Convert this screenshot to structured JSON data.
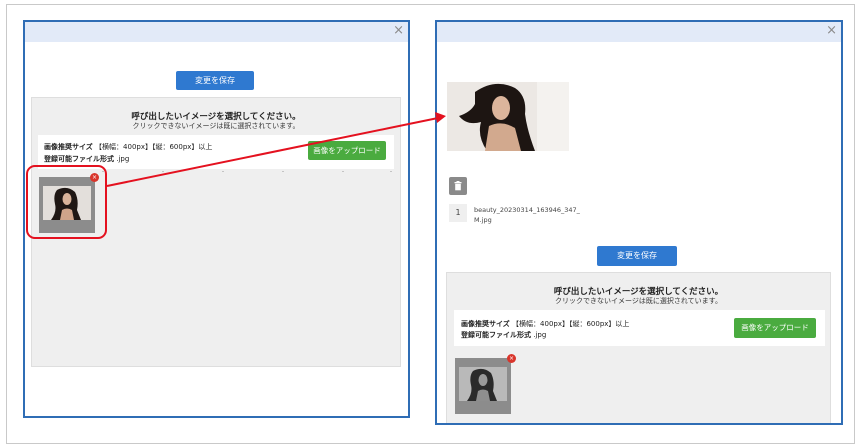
{
  "left_dialog": {
    "close_glyph": "×",
    "save_label": "変更を保存",
    "panel_title": "呼び出したいイメージを選択してください。",
    "panel_subtitle": "クリックできないイメージは既に選択されています。",
    "size_label": "画像推奨サイズ",
    "size_value": "【横幅：400px】【縦：600px】以上",
    "format_label": "登録可能ファイル形式",
    "format_value": ".jpg",
    "upload_label": "画像をアップロード",
    "remove_glyph": "×"
  },
  "right_dialog": {
    "close_glyph": "×",
    "trash_icon": "trash-icon",
    "file_index": "1",
    "file_name_line1": "beauty_20230314_163946_347_",
    "file_name_line2": "M.jpg",
    "save_label": "変更を保存",
    "panel_title": "呼び出したいイメージを選択してください。",
    "panel_subtitle": "クリックできないイメージは既に選択されています。",
    "size_label": "画像推奨サイズ",
    "size_value": "【横幅：400px】【縦：600px】以上",
    "format_label": "登録可能ファイル形式",
    "format_value": ".jpg",
    "upload_label": "画像をアップロード",
    "remove_glyph": "×"
  },
  "colors": {
    "dialog_border": "#2f6db5",
    "header_bg": "#e2eaf8",
    "save_button": "#2f79d0",
    "upload_button": "#4aab3f",
    "remove_badge": "#d9352b",
    "annotation": "#e4111f"
  }
}
